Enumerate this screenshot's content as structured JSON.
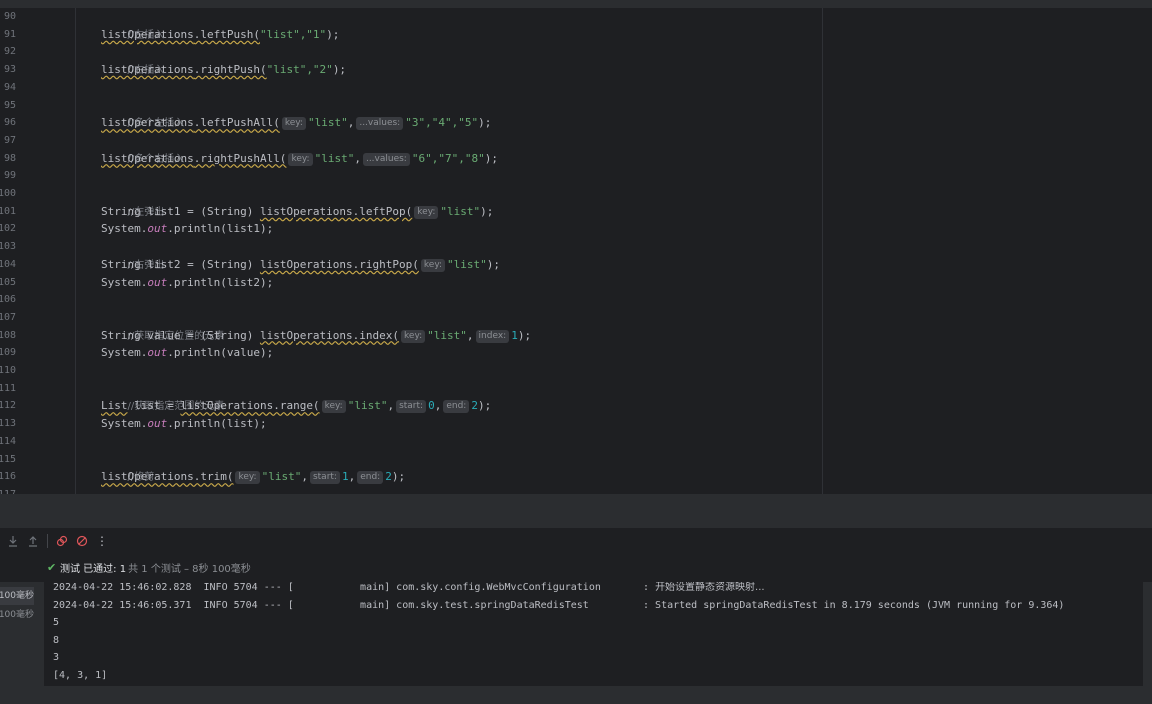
{
  "editor": {
    "line_numbers": [
      "90",
      "91",
      "92",
      "93",
      "94",
      "95",
      "96",
      "97",
      "98",
      "99",
      "100",
      "101",
      "102",
      "103",
      "104",
      "105",
      "106",
      "107",
      "108",
      "109",
      "110",
      "111",
      "112",
      "113",
      "114",
      "115",
      "116",
      "117"
    ],
    "comments": {
      "c90": "//左插入",
      "c92": "//右插入",
      "c95": "//多个左插入",
      "c97": "//多个右插入",
      "c100": "//左弹出",
      "c103": "//右弹出",
      "c107": "//获取指定位置的元素",
      "c111": "//获取指定范围的元素",
      "c115": "//修剪"
    },
    "code": {
      "var": "listOperations",
      "l91_call": ".leftPush(",
      "l91_args": "\"list\",\"1\"",
      "l93_call": ".rightPush(",
      "l93_args": "\"list\",\"2\"",
      "l96_call": ".leftPushAll(",
      "l96_vals": "\"3\",\"4\",\"5\"",
      "l98_call": ".rightPushAll(",
      "l98_vals": "\"6\",\"7\",\"8\"",
      "l101_decl": "String list1 = (String) ",
      "l101_call": "listOperations.leftPop(",
      "l102": "println(list1);",
      "l104_decl": "String list2 = (String) ",
      "l104_call": "listOperations.rightPop(",
      "l105": "println(list2);",
      "l108_decl": "String value = (String) ",
      "l108_call": "listOperations.index(",
      "l108_idx": "1",
      "l109": "println(value);",
      "l112_type": "List",
      "l112_decl": " list = ",
      "l112_call": "listOperations.range(",
      "l112_start": "0",
      "l112_end": "2",
      "l113": "println(list);",
      "l116_call": "listOperations.trim(",
      "l116_start": "1",
      "l116_end": "2",
      "l117": "}",
      "str_list": "\"list\"",
      "sys": "System.",
      "out": "out",
      "dot": ".",
      "end_stmt": ");"
    },
    "hints": {
      "key": "key:",
      "values": "...values:",
      "index": "index:",
      "start": "start:",
      "end": "end:"
    }
  },
  "toolbar": {
    "more_label": "⋮"
  },
  "test_status": {
    "passed": "测试 已通过: 1",
    "summary": "共 1 个测试 – 8秒 100毫秒"
  },
  "test_tree": {
    "times": [
      "100毫秒",
      "100毫秒"
    ]
  },
  "console": {
    "lines": [
      "2024-04-22 15:46:02.828  INFO 5704 --- [           main] com.sky.config.WebMvcConfiguration       : ",
      "2024-04-22 15:46:05.371  INFO 5704 --- [           main] com.sky.test.springDataRedisTest         : Started springDataRedisTest in 8.179 seconds (JVM running for 9.364)",
      "5",
      "8",
      "3",
      "[4, 3, 1]"
    ],
    "line1_cn": "开始设置静态资源映射..."
  }
}
